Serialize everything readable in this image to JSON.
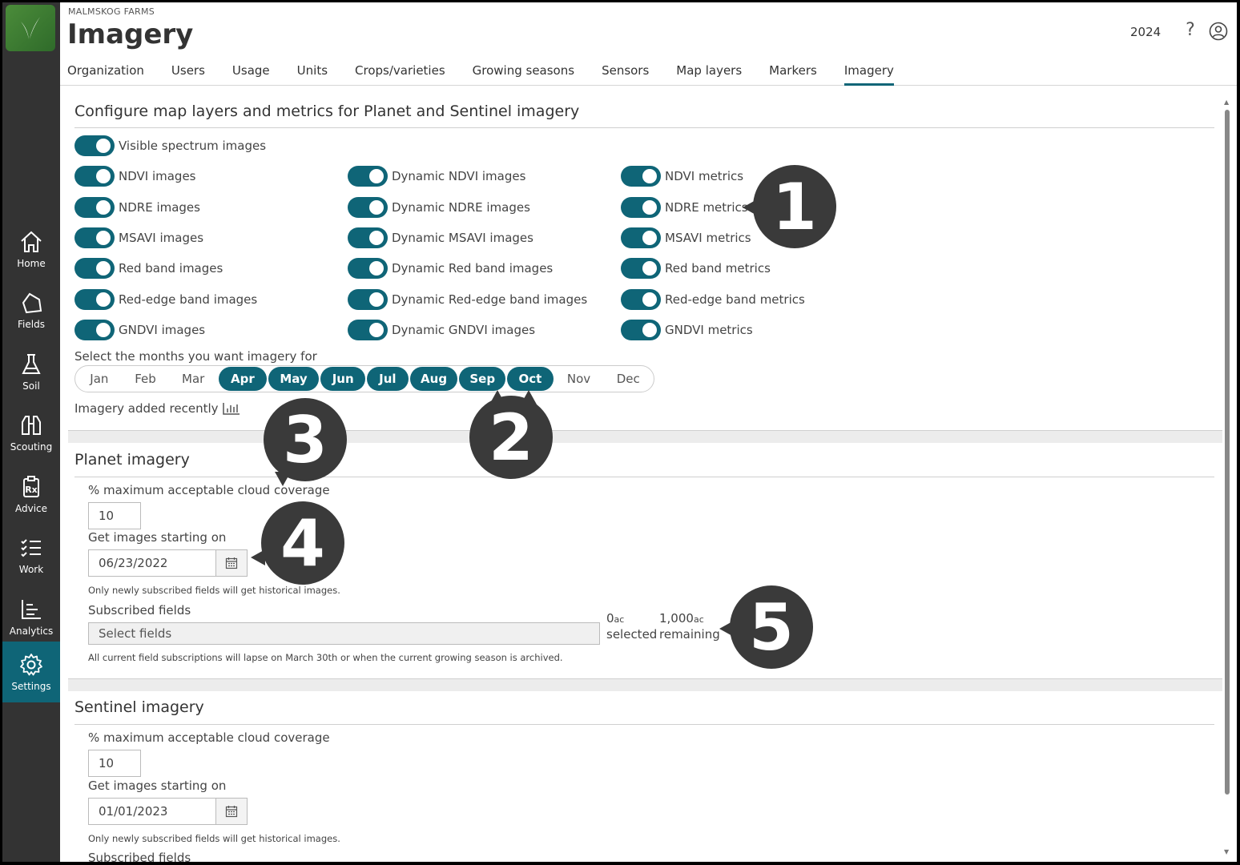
{
  "org_name": "MALMSKOG FARMS",
  "page_title": "Imagery",
  "year": "2024",
  "help_glyph": "?",
  "sidebar": {
    "items": [
      {
        "label": "Home",
        "icon": "home-icon"
      },
      {
        "label": "Fields",
        "icon": "field-shape-icon"
      },
      {
        "label": "Soil",
        "icon": "flask-icon"
      },
      {
        "label": "Scouting",
        "icon": "binoculars-icon"
      },
      {
        "label": "Advice",
        "icon": "prescription-icon"
      },
      {
        "label": "Work",
        "icon": "checklist-icon"
      },
      {
        "label": "Analytics",
        "icon": "bar-chart-icon"
      },
      {
        "label": "Settings",
        "icon": "gear-icon",
        "active": true
      }
    ]
  },
  "tabs": [
    {
      "label": "Organization"
    },
    {
      "label": "Users"
    },
    {
      "label": "Usage"
    },
    {
      "label": "Units"
    },
    {
      "label": "Crops/varieties"
    },
    {
      "label": "Growing seasons"
    },
    {
      "label": "Sensors"
    },
    {
      "label": "Map layers"
    },
    {
      "label": "Markers"
    },
    {
      "label": "Imagery",
      "active": true
    }
  ],
  "config": {
    "title": "Configure map layers and metrics for Planet and Sentinel imagery",
    "visible_toggle": "Visible spectrum images",
    "col1": [
      "NDVI images",
      "NDRE images",
      "MSAVI images",
      "Red band images",
      "Red-edge band images",
      "GNDVI images"
    ],
    "col2": [
      "Dynamic NDVI images",
      "Dynamic NDRE images",
      "Dynamic MSAVI images",
      "Dynamic Red band images",
      "Dynamic Red-edge band images",
      "Dynamic GNDVI images"
    ],
    "col3": [
      "NDVI metrics",
      "NDRE metrics",
      "MSAVI metrics",
      "Red band metrics",
      "Red-edge band metrics",
      "GNDVI metrics"
    ],
    "months_label": "Select the months you want imagery for",
    "months": [
      {
        "label": "Jan",
        "selected": false
      },
      {
        "label": "Feb",
        "selected": false
      },
      {
        "label": "Mar",
        "selected": false
      },
      {
        "label": "Apr",
        "selected": true
      },
      {
        "label": "May",
        "selected": true
      },
      {
        "label": "Jun",
        "selected": true
      },
      {
        "label": "Jul",
        "selected": true
      },
      {
        "label": "Aug",
        "selected": true
      },
      {
        "label": "Sep",
        "selected": true
      },
      {
        "label": "Oct",
        "selected": true
      },
      {
        "label": "Nov",
        "selected": false
      },
      {
        "label": "Dec",
        "selected": false
      }
    ],
    "recent_label": "Imagery added recently"
  },
  "planet": {
    "title": "Planet imagery",
    "cloud_label": "% maximum acceptable cloud coverage",
    "cloud_value": "10",
    "start_label": "Get images starting on",
    "start_value": "06/23/2022",
    "historical_note": "Only newly subscribed fields will get historical images.",
    "subscribed_label": "Subscribed fields",
    "select_placeholder": "Select fields",
    "selected_value": "0",
    "selected_unit": "ac",
    "selected_label": "selected",
    "remaining_value": "1,000",
    "remaining_unit": "ac",
    "remaining_label": "remaining",
    "lapse_note": "All current field subscriptions will lapse on March 30th or when the current growing season is archived."
  },
  "sentinel": {
    "title": "Sentinel imagery",
    "cloud_label": "% maximum acceptable cloud coverage",
    "cloud_value": "10",
    "start_label": "Get images starting on",
    "start_value": "01/01/2023",
    "historical_note": "Only newly subscribed fields will get historical images.",
    "subscribed_label": "Subscribed fields"
  },
  "callouts": [
    "1",
    "2",
    "3",
    "4",
    "5"
  ],
  "colors": {
    "accent": "#0f6577",
    "sidebar": "#333333",
    "callout": "#3a3a3a"
  }
}
